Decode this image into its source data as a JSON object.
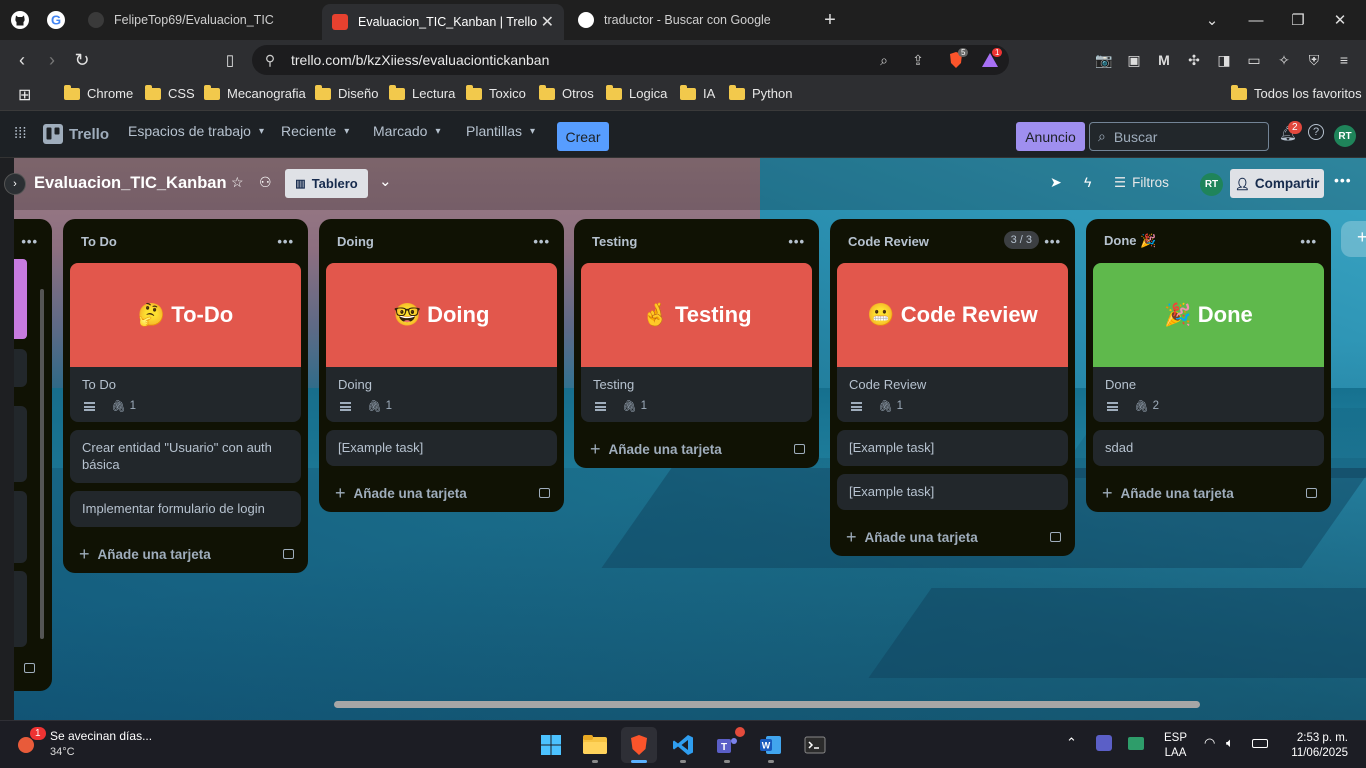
{
  "browser": {
    "tabs": [
      {
        "title": "FelipeTop69/Evaluacion_TIC",
        "active": false
      },
      {
        "title": "Evaluacion_TIC_Kanban | Trello",
        "active": true
      },
      {
        "title": "traductor - Buscar con Google",
        "active": false
      }
    ],
    "url": "trello.com/b/kzXiiess/evaluaciontickanban",
    "brave_badge": "5",
    "alert_badge": "1",
    "bookmarks": [
      "Chrome",
      "CSS",
      "Mecanografia",
      "Diseño",
      "Lectura",
      "Toxico",
      "Otros",
      "Logica",
      "IA",
      "Python"
    ],
    "all_bookmarks": "Todos los favoritos"
  },
  "trello": {
    "logo": "Trello",
    "nav": [
      "Espacios de trabajo",
      "Reciente",
      "Marcado",
      "Plantillas"
    ],
    "create": "Crear",
    "announcement": "Anuncio",
    "search_placeholder": "Buscar",
    "notifications_count": "2",
    "user_initials": "RT"
  },
  "board": {
    "title": "Evaluacion_TIC_Kanban",
    "view": "Tablero",
    "filters": "Filtros",
    "share": "Compartir",
    "member_initials": "RT",
    "add_card": "Añade una tarjeta",
    "lists": [
      {
        "name": "To Do",
        "cards": [
          {
            "cover_text": "🤔 To-Do",
            "cover_color": "#e2574c",
            "title": "To Do",
            "attachments": "1"
          },
          {
            "title": "Crear entidad \"Usuario\" con auth básica"
          },
          {
            "title": "Implementar formulario de login"
          }
        ]
      },
      {
        "name": "Doing",
        "cards": [
          {
            "cover_text": "🤓 Doing",
            "cover_color": "#e2574c",
            "title": "Doing",
            "attachments": "1"
          },
          {
            "title": "[Example task]"
          }
        ]
      },
      {
        "name": "Testing",
        "cards": [
          {
            "cover_text": "🤞 Testing",
            "cover_color": "#e2574c",
            "title": "Testing",
            "attachments": "1"
          }
        ]
      },
      {
        "name": "Code Review",
        "count": "3 / 3",
        "cards": [
          {
            "cover_text": "😬 Code Review",
            "cover_color": "#e2574c",
            "title": "Code Review",
            "attachments": "1"
          },
          {
            "title": "[Example task]"
          },
          {
            "title": "[Example task]"
          }
        ]
      },
      {
        "name": "Done 🎉",
        "cards": [
          {
            "cover_text": "🎉 Done",
            "cover_color": "#5fb94c",
            "title": "Done",
            "attachments": "2"
          },
          {
            "title": "sdad"
          }
        ]
      }
    ]
  },
  "taskbar": {
    "weather_title": "Se avecinan días...",
    "weather_temp": "34°C",
    "weather_badge": "1",
    "lang_top": "ESP",
    "lang_bottom": "LAA",
    "time": "2:53 p. m.",
    "date": "11/06/2025"
  }
}
